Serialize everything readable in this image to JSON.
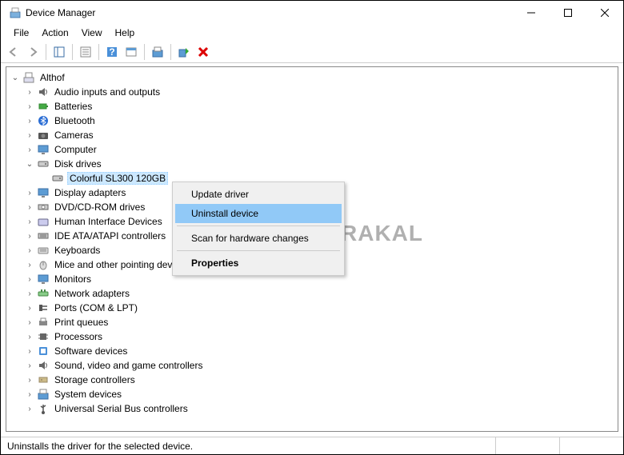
{
  "window": {
    "title": "Device Manager"
  },
  "menu": {
    "file": "File",
    "action": "Action",
    "view": "View",
    "help": "Help"
  },
  "tree": {
    "root": "Althof",
    "nodes": {
      "audio": "Audio inputs and outputs",
      "batteries": "Batteries",
      "bluetooth": "Bluetooth",
      "cameras": "Cameras",
      "computer": "Computer",
      "disk": "Disk drives",
      "disk_child": "Colorful SL300 120GB",
      "display": "Display adapters",
      "dvd": "DVD/CD-ROM drives",
      "hid": "Human Interface Devices",
      "ide": "IDE ATA/ATAPI controllers",
      "keyboards": "Keyboards",
      "mice": "Mice and other pointing devices",
      "monitors": "Monitors",
      "network": "Network adapters",
      "ports": "Ports (COM & LPT)",
      "printq": "Print queues",
      "processors": "Processors",
      "software": "Software devices",
      "sound": "Sound, video and game controllers",
      "storage": "Storage controllers",
      "system": "System devices",
      "usb": "Universal Serial Bus controllers"
    }
  },
  "context_menu": {
    "update": "Update driver",
    "uninstall": "Uninstall device",
    "scan": "Scan for hardware changes",
    "properties": "Properties"
  },
  "status": {
    "text": "Uninstalls the driver for the selected device."
  },
  "watermark": "BERAKAL"
}
